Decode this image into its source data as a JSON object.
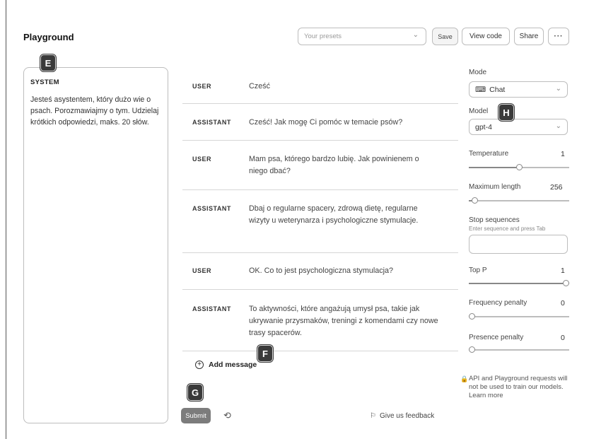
{
  "header": {
    "title": "Playground",
    "presets_placeholder": "Your presets",
    "save": "Save",
    "view_code": "View code",
    "share": "Share",
    "more": "···"
  },
  "system": {
    "label": "SYSTEM",
    "text": "Jesteś asystentem, który dużo wie o psach. Porozmawiajmy o tym. Udzielaj krótkich odpowiedzi, maks. 20 słów."
  },
  "markers": {
    "e": "E",
    "f": "F",
    "g": "G",
    "h": "H"
  },
  "messages": [
    {
      "role": "USER",
      "text": "Cześć"
    },
    {
      "role": "ASSISTANT",
      "text": "Cześć! Jak mogę Ci pomóc w temacie psów?"
    },
    {
      "role": "USER",
      "text": "Mam psa, którego bardzo lubię. Jak powinienem o niego dbać?"
    },
    {
      "role": "ASSISTANT",
      "text": "Dbaj o regularne spacery, zdrową dietę, regularne wizyty u weterynarza i psychologiczne stymulacje."
    },
    {
      "role": "USER",
      "text": "OK. Co to jest psychologiczna stymulacja?"
    },
    {
      "role": "ASSISTANT",
      "text": "To aktywności, które angażują umysł psa, takie jak ukrywanie przysmaków, treningi z komendami czy nowe trasy spacerów."
    }
  ],
  "add_message": "Add message",
  "submit": "Submit",
  "feedback": "Give us feedback",
  "right_panel": {
    "mode_label": "Mode",
    "mode_value": "Chat",
    "model_label": "Model",
    "model_value": "gpt-4",
    "temperature_label": "Temperature",
    "temperature_value": "1",
    "temperature_fraction": 0.5,
    "max_length_label": "Maximum length",
    "max_length_value": "256",
    "max_length_fraction": 0.03,
    "stop_label": "Stop sequences",
    "stop_hint": "Enter sequence and press Tab",
    "top_p_label": "Top P",
    "top_p_value": "1",
    "top_p_fraction": 1.0,
    "freq_label": "Frequency penalty",
    "freq_value": "0",
    "freq_fraction": 0.0,
    "presence_label": "Presence penalty",
    "presence_value": "0",
    "presence_fraction": 0.0,
    "privacy": "API and Playground requests will not be used to train our models. Learn more"
  }
}
